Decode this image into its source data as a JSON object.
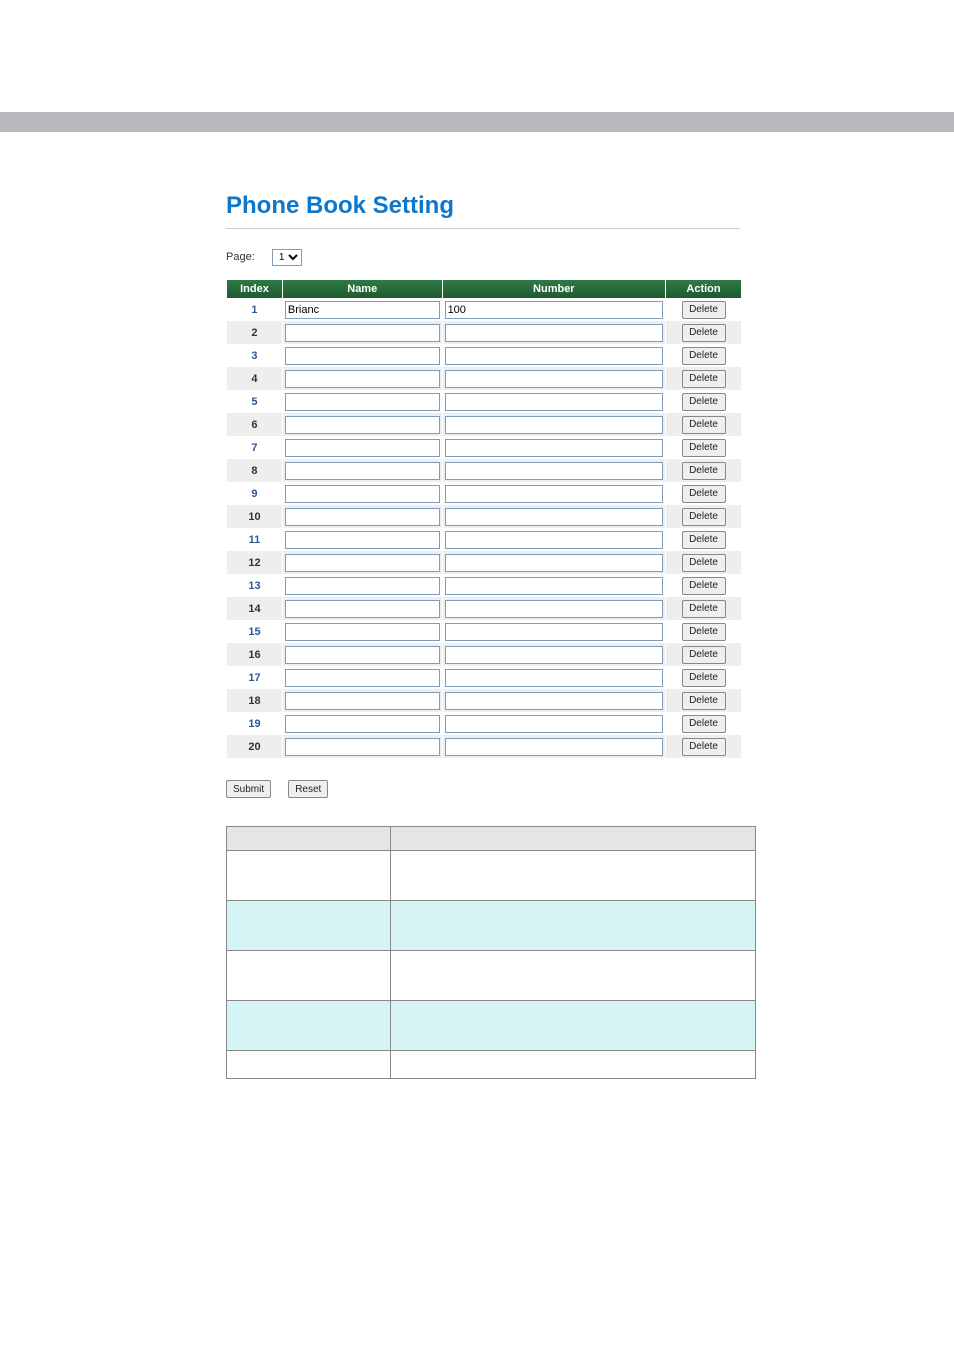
{
  "title": "Phone Book Setting",
  "page_label": "Page:",
  "page_options": [
    "1"
  ],
  "page_selected": "1",
  "headers": {
    "index": "Index",
    "name": "Name",
    "number": "Number",
    "action": "Action"
  },
  "delete_label": "Delete",
  "submit_label": "Submit",
  "reset_label": "Reset",
  "rows": [
    {
      "index": "1",
      "name": "Brianc",
      "number": "100"
    },
    {
      "index": "2",
      "name": "",
      "number": ""
    },
    {
      "index": "3",
      "name": "",
      "number": ""
    },
    {
      "index": "4",
      "name": "",
      "number": ""
    },
    {
      "index": "5",
      "name": "",
      "number": ""
    },
    {
      "index": "6",
      "name": "",
      "number": ""
    },
    {
      "index": "7",
      "name": "",
      "number": ""
    },
    {
      "index": "8",
      "name": "",
      "number": ""
    },
    {
      "index": "9",
      "name": "",
      "number": ""
    },
    {
      "index": "10",
      "name": "",
      "number": ""
    },
    {
      "index": "11",
      "name": "",
      "number": ""
    },
    {
      "index": "12",
      "name": "",
      "number": ""
    },
    {
      "index": "13",
      "name": "",
      "number": ""
    },
    {
      "index": "14",
      "name": "",
      "number": ""
    },
    {
      "index": "15",
      "name": "",
      "number": ""
    },
    {
      "index": "16",
      "name": "",
      "number": ""
    },
    {
      "index": "17",
      "name": "",
      "number": ""
    },
    {
      "index": "18",
      "name": "",
      "number": ""
    },
    {
      "index": "19",
      "name": "",
      "number": ""
    },
    {
      "index": "20",
      "name": "",
      "number": ""
    }
  ],
  "lower_table": {
    "rows": [
      {
        "kind": "hdr",
        "a": "",
        "b": ""
      },
      {
        "kind": "white",
        "a": "",
        "b": ""
      },
      {
        "kind": "blue",
        "a": "",
        "b": ""
      },
      {
        "kind": "white",
        "a": "",
        "b": ""
      },
      {
        "kind": "blue",
        "a": "",
        "b": ""
      },
      {
        "kind": "last",
        "a": "",
        "b": ""
      }
    ]
  }
}
